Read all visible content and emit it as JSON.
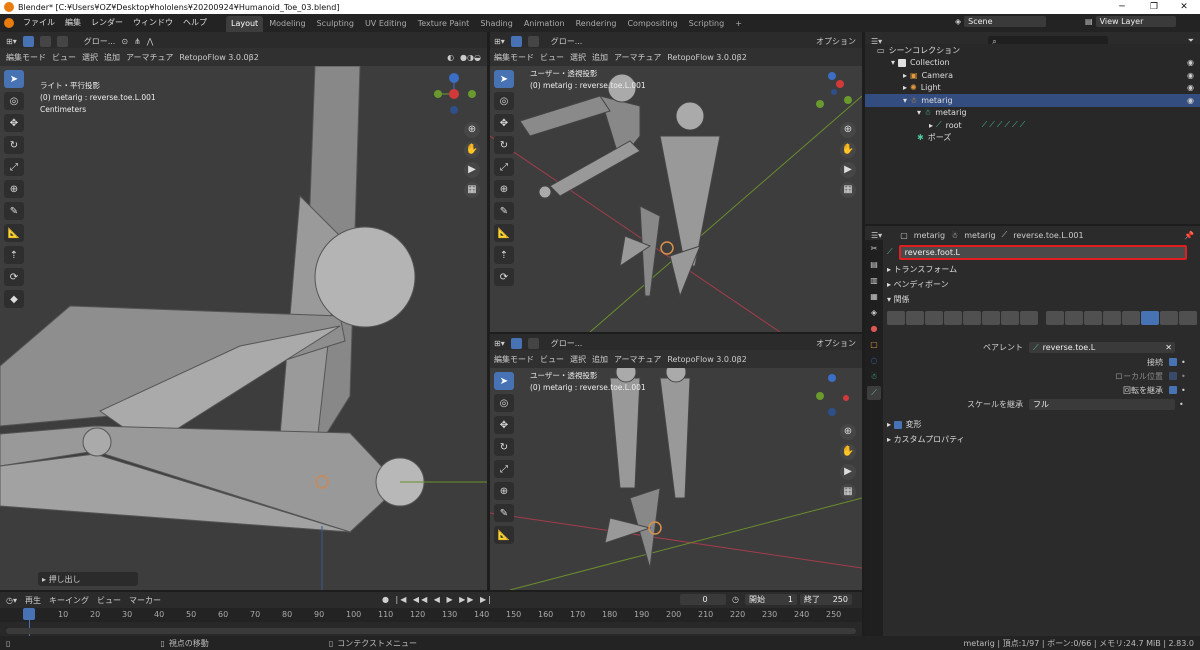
{
  "window": {
    "title": "Blender* [C:¥Users¥OZ¥Desktop¥hololens¥20200924¥Humanoid_Toe_03.blend]",
    "min": "─",
    "max": "❐",
    "close": "✕"
  },
  "menu": [
    "ファイル",
    "編集",
    "レンダー",
    "ウィンドウ",
    "ヘルプ"
  ],
  "workspaces": [
    "Layout",
    "Modeling",
    "Sculpting",
    "UV Editing",
    "Texture Paint",
    "Shading",
    "Animation",
    "Rendering",
    "Compositing",
    "Scripting"
  ],
  "scene": {
    "scene_label": "Scene",
    "view_layer": "View Layer"
  },
  "viewport_header": {
    "mode": "編集モード",
    "view": "ビュー",
    "select": "選択",
    "add": "追加",
    "armature": "アーマチュア",
    "addon": "RetopoFlow 3.0.0β2",
    "orientation": "グロー...",
    "options": "オプション"
  },
  "viewports": [
    {
      "line1": "ライト・平行投影",
      "line2": "(0) metarig : reverse.toe.L.001",
      "line3": "Centimeters",
      "push": "押し出し"
    },
    {
      "line1": "ユーザー・透視投影",
      "line2": "(0) metarig : reverse.toe.L.001"
    },
    {
      "line1": "ユーザー・透視投影",
      "line2": "(0) metarig : reverse.toe.L.001"
    }
  ],
  "outliner": {
    "root": "シーンコレクション",
    "items": [
      {
        "label": "Collection",
        "indent": 1
      },
      {
        "label": "Camera",
        "indent": 2
      },
      {
        "label": "Light",
        "indent": 2
      },
      {
        "label": "metarig",
        "indent": 2,
        "selected": true
      },
      {
        "label": "metarig",
        "indent": 3
      },
      {
        "label": "root",
        "indent": 4
      },
      {
        "label": "ポーズ",
        "indent": 3
      }
    ]
  },
  "properties": {
    "breadcrumb": [
      "metarig",
      "metarig",
      "reverse.toe.L.001"
    ],
    "bone_name": "reverse.foot.L",
    "panels": {
      "transform": "トランスフォーム",
      "bendy": "ベンディボーン",
      "relations": "関係",
      "deform": "変形",
      "custom": "カスタムプロパティ"
    },
    "parent_label": "ペアレント",
    "parent_value": "reverse.toe.L",
    "connected": "接続",
    "local_location": "ローカル位置",
    "inherit_rotation": "回転を継承",
    "inherit_scale_label": "スケールを継承",
    "inherit_scale_value": "フル"
  },
  "timeline": {
    "playback": "再生",
    "keying": "キーイング",
    "view": "ビュー",
    "marker": "マーカー",
    "current": "0",
    "start_label": "開始",
    "start": "1",
    "end_label": "終了",
    "end": "250",
    "ticks": [
      "0",
      "10",
      "20",
      "30",
      "40",
      "50",
      "60",
      "70",
      "80",
      "90",
      "100",
      "110",
      "120",
      "130",
      "140",
      "150",
      "160",
      "170",
      "180",
      "190",
      "200",
      "210",
      "220",
      "230",
      "240",
      "250"
    ]
  },
  "status": {
    "left": "視点の移動",
    "mid": "コンテクストメニュー",
    "right": "metarig | 頂点:1/97 | ボーン:0/66 | メモリ:24.7 MiB | 2.83.0"
  }
}
